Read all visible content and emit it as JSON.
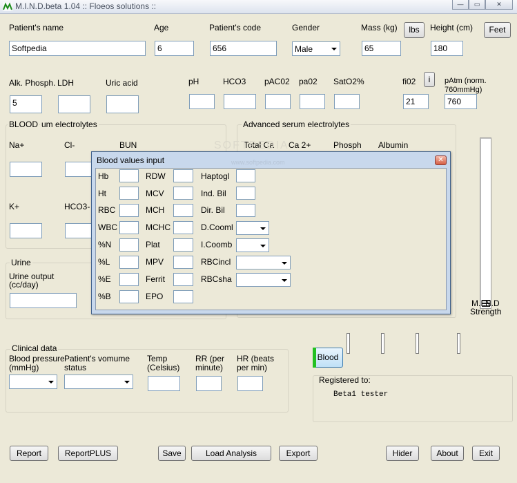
{
  "window": {
    "title": "M.I.N.D.beta 1.04   :: Floeos solutions ::",
    "minimize_glyph": "—",
    "restore_glyph": "▭",
    "close_glyph": "✕"
  },
  "patient": {
    "name_label": "Patient's name",
    "name_value": "Softpedia",
    "age_label": "Age",
    "age_value": "6",
    "code_label": "Patient's code",
    "code_value": "656",
    "gender_label": "Gender",
    "gender_value": "Male",
    "mass_label": "Mass (kg)",
    "mass_value": "65",
    "lbs_button": "lbs",
    "height_label": "Height (cm)",
    "height_value": "180",
    "feet_button": "Feet"
  },
  "chem": {
    "alk_label": "Alk. Phosph.",
    "alk_value": "5",
    "ldh_label": "LDH",
    "uric_label": "Uric acid",
    "ph_label": "pH",
    "hco3_label": "HCO3",
    "paco2_label": "pAC02",
    "pao2_label": "pa02",
    "sato2_label": "SatO2%",
    "fio2_label": "fi02",
    "fio2_value": "21",
    "info_button": "i",
    "patm_label_1": "pAtm (norm.",
    "patm_label_2": "760mmHg)",
    "patm_value": "760"
  },
  "blood_group": {
    "label": "BLOOD",
    "sub_label": "um electrolytes",
    "na": "Na+",
    "cl": "Cl-",
    "bun": "BUN",
    "k": "K+",
    "hco3": "HCO3-"
  },
  "advanced": {
    "label": "Advanced serum electrolytes",
    "total_ca": "Total Ca",
    "ca2": "Ca 2+",
    "phosph": "Phosph",
    "albumin": "Albumin"
  },
  "urine": {
    "label": "Urine",
    "output_label_1": "Urine output",
    "output_label_2": "(cc/day)"
  },
  "clinical": {
    "label": "Clinical data",
    "bp_label_1": "Blood pressure",
    "bp_label_2": "(mmHg)",
    "vol_label_1": "Patient's vomume",
    "vol_label_2": "status",
    "temp_label_1": "Temp",
    "temp_label_2": "(Celsius)",
    "rr_label_1": "RR (per",
    "rr_label_2": "minute)",
    "hr_label_1": "HR (beats",
    "hr_label_2": "per min)"
  },
  "strength": {
    "label_1": "M.I.N.D",
    "label_2": "Strength",
    "level": 0.02
  },
  "blood_button": "Blood",
  "registered": {
    "label": "Registered to:",
    "value": "Beta1 tester"
  },
  "buttons": {
    "report": "Report",
    "report_plus": "ReportPLUS",
    "save": "Save",
    "load": "Load Analysis",
    "export": "Export",
    "hider": "Hider",
    "about": "About",
    "exit": "Exit"
  },
  "watermark": {
    "brand": "SOFTPEDIA",
    "url": "www.softpedia.com"
  },
  "dialog": {
    "title": "Blood values input",
    "close_glyph": "✕",
    "col1": [
      "Hb",
      "Ht",
      "RBC",
      "WBC",
      "%N",
      "%L",
      "%E",
      "%B"
    ],
    "col2": [
      "RDW",
      "MCV",
      "MCH",
      "MCHC",
      "Plat",
      "MPV",
      "Ferrit",
      "EPO"
    ],
    "col3": [
      "Haptogl",
      "Ind. Bil",
      "Dir. Bil",
      "D.Cooml",
      "I.Coomb",
      "RBCincl",
      "RBCsha"
    ]
  },
  "colors": {
    "window_bg": "#ece9d8",
    "field_border": "#7f9db9",
    "dialog_frame": "#c8d8ec",
    "blood_indicator": "#22c022"
  }
}
